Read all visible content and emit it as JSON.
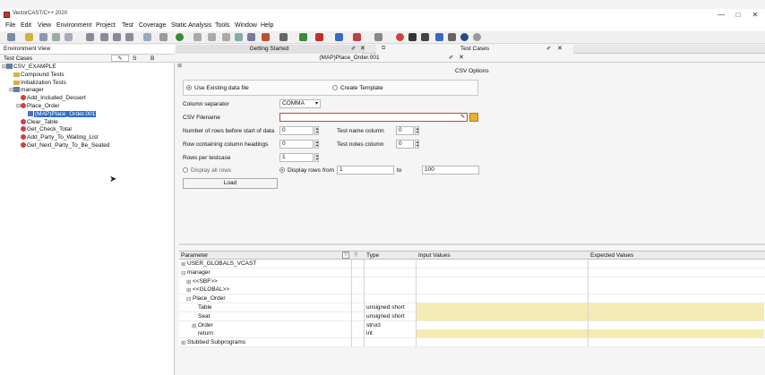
{
  "window": {
    "title": "VectorCAST/C++ 2020",
    "controls": [
      "—",
      "□",
      "✕"
    ]
  },
  "menu": [
    "File",
    "Edit",
    "View",
    "Environment",
    "Project",
    "Test",
    "Coverage",
    "Static Analysis",
    "Tools",
    "Window",
    "Help"
  ],
  "left": {
    "env_view_label": "Environment View",
    "test_cases_label": "Test Cases",
    "col_s": "S",
    "col_b": "B",
    "tree": [
      {
        "label": "CSV_EXAMPLE",
        "icon": "environment-icon",
        "depth": 0,
        "expander": "⊟"
      },
      {
        "label": "Compound Tests",
        "icon": "folder-icon",
        "depth": 1,
        "expander": ""
      },
      {
        "label": "Initialization Tests",
        "icon": "folder-icon",
        "depth": 1,
        "expander": ""
      },
      {
        "label": "manager",
        "icon": "unit-icon",
        "depth": 1,
        "expander": "⊟"
      },
      {
        "label": "Add_Included_Dessert",
        "icon": "subprogram-icon",
        "depth": 2,
        "expander": ""
      },
      {
        "label": "Place_Order",
        "icon": "subprogram-icon",
        "depth": 2,
        "expander": "⊟"
      },
      {
        "label": "(MAP)Place_Order.001",
        "icon": "testcase-icon",
        "depth": 3,
        "expander": "",
        "selected": true
      },
      {
        "label": "Clear_Table",
        "icon": "subprogram-icon",
        "depth": 2,
        "expander": ""
      },
      {
        "label": "Get_Check_Total",
        "icon": "subprogram-icon",
        "depth": 2,
        "expander": ""
      },
      {
        "label": "Add_Party_To_Waiting_List",
        "icon": "subprogram-icon",
        "depth": 2,
        "expander": ""
      },
      {
        "label": "Get_Next_Party_To_Be_Seated",
        "icon": "subprogram-icon",
        "depth": 2,
        "expander": ""
      }
    ]
  },
  "tabs": {
    "getting_started": "Getting Started",
    "test_cases": "Test Cases",
    "sub_tab": "(MAP)Place_Order.001"
  },
  "csv": {
    "section_title": "CSV Options",
    "use_existing": "Use Existing data file",
    "create_template": "Create Template",
    "column_separator_label": "Column separator",
    "column_separator_value": "COMMA",
    "csv_filename_label": "CSV Filename",
    "csv_filename_value": "",
    "rows_before_label": "Number of rows before start of data",
    "rows_before_value": "0",
    "test_name_col_label": "Test name column",
    "test_name_col_value": "0",
    "heading_row_label": "Row containing column headings",
    "heading_row_value": "0",
    "test_notes_col_label": "Test notes column",
    "test_notes_col_value": "0",
    "rows_per_testcase_label": "Rows per testcase",
    "rows_per_testcase_value": "1",
    "display_all": "Display all rows",
    "display_rows": "Display rows",
    "from_label": "from",
    "from_value": "1",
    "to_label": "to",
    "to_value": "100",
    "load_button": "Load"
  },
  "grid": {
    "headers": {
      "parameter": "Parameter",
      "type": "Type",
      "input": "Input Values",
      "expected": "Expected Values"
    },
    "rows": [
      {
        "label": "USER_GLOBALS_VCAST",
        "type": "",
        "prefix": "⊞",
        "indent": 0,
        "highlight": false
      },
      {
        "label": "manager",
        "type": "",
        "prefix": "⊟",
        "indent": 0,
        "highlight": false
      },
      {
        "label": "<<SBF>>",
        "type": "",
        "prefix": "⊞",
        "indent": 1,
        "highlight": false
      },
      {
        "label": "<<GLOBAL>>",
        "type": "",
        "prefix": "⊞",
        "indent": 1,
        "highlight": false
      },
      {
        "label": "Place_Order",
        "type": "",
        "prefix": "⊟",
        "indent": 1,
        "highlight": false
      },
      {
        "label": "Table",
        "type": "unsigned short",
        "prefix": "",
        "indent": 2,
        "highlight": true
      },
      {
        "label": "Seat",
        "type": "unsigned short",
        "prefix": "",
        "indent": 2,
        "highlight": true
      },
      {
        "label": "Order",
        "type": "struct",
        "prefix": "⊞",
        "indent": 2,
        "highlight": false
      },
      {
        "label": "return",
        "type": "int",
        "prefix": "",
        "indent": 2,
        "highlight": true
      },
      {
        "label": "Stubbed Subprograms",
        "type": "",
        "prefix": "⊞",
        "indent": 0,
        "highlight": false
      }
    ]
  },
  "colors": {
    "selected_bg": "#2a6fc9",
    "highlight_row": "#f4ecb0",
    "filename_border": "#d04040"
  }
}
